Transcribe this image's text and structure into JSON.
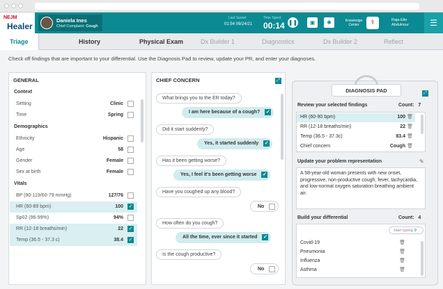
{
  "topbar": {
    "logo_top": "NEJM",
    "logo_main": "Healer",
    "patient_name": "Daniela Ines",
    "chief_complaint_label": "Chief Complaint:",
    "chief_complaint": "Cough",
    "last_saved_label": "Last Saved",
    "last_saved_value": "01:54 09/24/21",
    "time_spent_label": "Time Spent",
    "time_spent_value": "00:14",
    "knowledge_center": "Knowledge Center",
    "user_first": "Raja-Elie",
    "user_last": "Abdulnour",
    "pause_icon": "pause-icon",
    "save_icon": "save-icon",
    "settings_icon": "gear-icon"
  },
  "tabs": [
    "Triage",
    "History",
    "Physical Exam",
    "Dx Builder 1",
    "Diagnostics",
    "Dx Builder 2",
    "Reflect"
  ],
  "instruction": "Check off findings that are important to your differential. Use the Diagnosis Pad to review, update your PR, and enter your diagnoses.",
  "general": {
    "header": "GENERAL",
    "sections": {
      "context": "Context",
      "demographics": "Demographics",
      "vitals": "Vitals"
    },
    "rows": [
      {
        "label": "Setting",
        "value": "Clinic"
      },
      {
        "label": "Time",
        "value": "Spring"
      },
      {
        "label": "Ethnicity",
        "value": "Hispanic"
      },
      {
        "label": "Age",
        "value": "58"
      },
      {
        "label": "Gender",
        "value": "Female"
      },
      {
        "label": "Sex at birth",
        "value": "Female"
      },
      {
        "label": "BP (90-119/60-79 mmHg)",
        "value": "127/76"
      },
      {
        "label": "HR (60-89 bpm)",
        "value": "100"
      },
      {
        "label": "Sp02 (96-99%)",
        "value": "94%"
      },
      {
        "label": "RR (12-18 breaths/min)",
        "value": "22"
      },
      {
        "label": "Temp (36.5 - 37.3 c)",
        "value": "38.4"
      }
    ]
  },
  "chief": {
    "header": "CHIEF CONCERN",
    "items": [
      {
        "q": "What brings you to the ER today?",
        "a": "I am here because of a cough?"
      },
      {
        "q": "Did it start suddenly?",
        "a": "Yes, it started suddenly"
      },
      {
        "q": "Has it been getting worse?",
        "a": "Yes, I feel it's been getting worse"
      },
      {
        "q": "Have you coughed up any blood?",
        "a": "No"
      },
      {
        "q": "How often do you cough?",
        "a": "All the time, ever since it started"
      },
      {
        "q": "Is the cough productive?",
        "a": "No"
      }
    ]
  },
  "pad": {
    "title": "DIAGNOSIS PAD",
    "review_label": "Review your selected findings",
    "count_label": "Count:",
    "review_count": "7",
    "findings": [
      {
        "label": "HR (60-90 bpm)",
        "value": "100"
      },
      {
        "label": "RR (12-18 breaths/min)",
        "value": "22"
      },
      {
        "label": "Temp (36.5 - 37.3c)",
        "value": "83.4"
      },
      {
        "label": "Chief concern",
        "value": "Cough"
      }
    ],
    "pr_label": "Update your problem representation",
    "pr_text": "A 58-year-old woman presents with new onset, progressive, non-productive cough, fever, tachycardia, and low-normal oxygen saturation breathing ambient air.",
    "ddx_label": "Build your differential",
    "ddx_count": "4",
    "ddx_placeholder": "Start typing",
    "ddx": [
      "Covid-19",
      "Pneumonia",
      "Influenza",
      "Asthma"
    ]
  }
}
